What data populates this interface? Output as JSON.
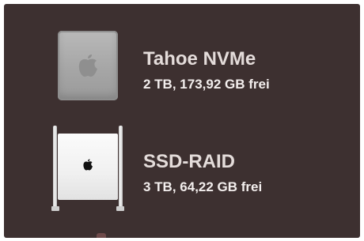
{
  "disks": [
    {
      "name": "Tahoe NVMe",
      "info": "2 TB, 173,92 GB frei",
      "icon": "drive-icon"
    },
    {
      "name": "SSD-RAID",
      "info": "3 TB, 64,22 GB frei",
      "icon": "mac-pro-icon"
    }
  ],
  "colors": {
    "background": "#3d3030",
    "text": "#f3eeed"
  }
}
